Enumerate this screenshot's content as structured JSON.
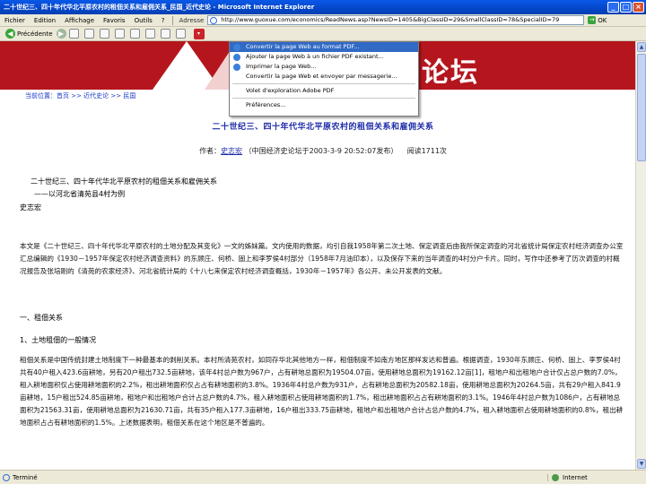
{
  "window": {
    "title": "二十世纪三、四十年代华北平原农村的租佃关系和雇佣关系_民国_近代史论 - Microsoft Internet Explorer",
    "controls": [
      "_",
      "□",
      "×"
    ]
  },
  "menu": {
    "items": [
      "Fichier",
      "Edition",
      "Affichage",
      "Favoris",
      "Outils",
      "?"
    ],
    "address_label": "Adresse",
    "address_url": "http://www.guoxue.com/economics/ReadNews.asp?NewsID=1405&BigClassID=29&SmallClassID=78&SpecialID=79",
    "go_label": "OK"
  },
  "toolbar": {
    "back_label": "Précédente"
  },
  "dropdown": {
    "items": [
      {
        "label": "Convertir la page Web au format PDF...",
        "highlighted": true
      },
      {
        "label": "Ajouter la page Web à un fichier PDF existant...",
        "highlighted": false
      },
      {
        "label": "Imprimer la page Web...",
        "highlighted": false
      },
      {
        "label": "Convertir la page Web et envoyer par messagerie...",
        "highlighted": false
      },
      {
        "label": "Volet d'exploration Adobe PDF",
        "highlighted": false
      },
      {
        "label": "Préférences...",
        "highlighted": false
      }
    ]
  },
  "banner": {
    "logo_text": "论坛",
    "color": "#b5161e"
  },
  "breadcrumb": "当前位置：首页 >> 近代史论 >> 民国",
  "article": {
    "title": "二十世纪三、四十年代华北平原农村的租佃关系和雇佣关系",
    "meta_prefix": "作者：",
    "author": "史志宏",
    "meta_source": "（中国经济史论坛于2003-3-9 20:52:07发布）",
    "reads": "阅读1711次",
    "heading1": "二十世纪三、四十年代华北平原农村的租佃关系和雇佣关系",
    "heading2": "——以河北省清苑县4村为例",
    "byline": "史志宏",
    "para1_a": "本文是《二十世纪三、四十年代华北平原农村的土地分配及其变化》一文的姊妹篇。文内使用的数据，均引自我1958年第二次土地、保定调查后由我所保定调查的河北省统计局保定农村经济调查办公室汇总编辑的《1930－1957年保定农村经济调查资料》的东顾庄、何桥、固上和李罗侯4村部分（1958年7月油印本），以及保存下来的当年调查的4村分户卡片。同时，写作中还参考了历次调查的村概况报告及张培刚的《清苑的农家经济》、河北省统计局的《十八七来保定农村经济调查概括，1930年－1957年》各公开、未公开发表的文献。",
    "section1": "一、租佃关系",
    "section2": "1、土地租佃的一般情况",
    "para2": "租佃关系是中国传统封建土地制度下一种最基本的剥削关系。本村所清苑农村，如同存华北其他地方一样，租佃制度不如南方地区那样发达和普遍。根据调查，1930年东顾庄、何桥、固上、李罗侯4村共有40户租入423.6亩耕地，另有20户租出732.5亩耕地，该年4村总户数为967户，占有耕地总面积为19504.07亩，使用耕地总面积为19162.12亩[1]，租地户和出租地户合计仅占总户数的7.0%，租入耕地面积仅占使用耕地面积的2.2%，租出耕地面积仅占占有耕地面积的3.8%。1936年4村总户数为931户，占有耕地总面积为20582.18亩，使用耕地总面积为20264.5亩，共有29户租入841.9亩耕地，15户租出524.85亩耕地，租地户和出租地户合计占总户数的4.7%，租入耕地面积占使用耕地面积的1.7%，租出耕地面积占占有耕地面积的3.1%。1946年4村总户数为1086户，占有耕地总面积为21563.31亩，使用耕地总面积为21630.71亩，共有35户租入177.3亩耕地，16户租出333.75亩耕地，租地户和出租地户合计占总户数的4.7%，租入耕地面积占使用耕地面积的0.8%，租出耕地面积占占有耕地面积的1.5%。上述数据表明，租佃关系在这个地区是不普遍的。"
  },
  "status": {
    "left": "Terminé",
    "right": "Internet"
  }
}
